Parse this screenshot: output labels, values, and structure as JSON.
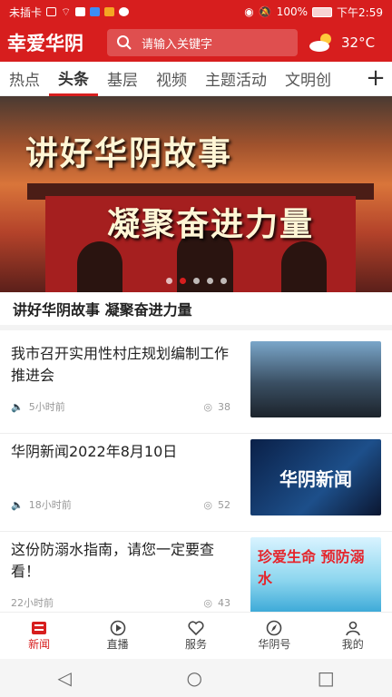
{
  "status": {
    "carrier": "未插卡",
    "battery": "100%",
    "time": "下午2:59"
  },
  "header": {
    "logo": "幸爱华阴",
    "search_placeholder": "请输入关键字",
    "temperature": "32°C"
  },
  "tabs": [
    {
      "label": "热点",
      "active": false
    },
    {
      "label": "头条",
      "active": true
    },
    {
      "label": "基层",
      "active": false
    },
    {
      "label": "视频",
      "active": false
    },
    {
      "label": "主题活动",
      "active": false
    },
    {
      "label": "文明创",
      "active": false
    }
  ],
  "banner": {
    "line1": "讲好华阴故事",
    "line2": "凝聚奋进力量",
    "caption": "讲好华阴故事 凝聚奋进力量",
    "active_slide_index": 2
  },
  "news": [
    {
      "title": "我市召开实用性村庄规划编制工作推进会",
      "time": "5小时前",
      "views": "38",
      "has_audio": true
    },
    {
      "title": "华阴新闻2022年8月10日",
      "time": "18小时前",
      "views": "52",
      "has_audio": true,
      "thumb_text": "华阴新闻"
    },
    {
      "title": "这份防溺水指南，请您一定要查看！",
      "time": "22小时前",
      "views": "43",
      "has_audio": false,
      "thumb_text": "珍爱生命 预防溺水"
    }
  ],
  "bottom_nav": [
    {
      "label": "新闻",
      "icon": "news-icon",
      "active": true
    },
    {
      "label": "直播",
      "icon": "live-icon",
      "active": false
    },
    {
      "label": "服务",
      "icon": "service-icon",
      "active": false
    },
    {
      "label": "华阴号",
      "icon": "compass-icon",
      "active": false
    },
    {
      "label": "我的",
      "icon": "user-icon",
      "active": false
    }
  ],
  "colors": {
    "brand_red": "#d71e1e"
  }
}
